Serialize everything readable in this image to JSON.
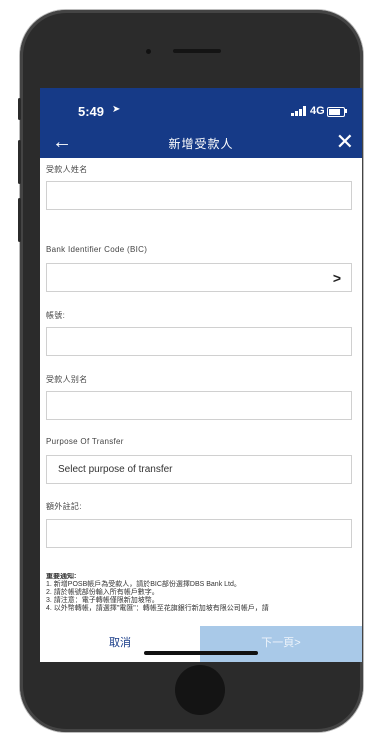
{
  "status_bar": {
    "time": "5:49",
    "network": "4G"
  },
  "header": {
    "title": "新增受款人",
    "back_icon": "arrow-left-icon",
    "close_icon": "close-icon"
  },
  "form": {
    "payee_name_label": "受款人姓名",
    "payee_name_value": "",
    "bic_label": "Bank Identifier Code (BIC)",
    "bic_value": "",
    "account_label": "帳號:",
    "account_value": "",
    "nickname_label": "受款人别名",
    "nickname_value": "",
    "purpose_label": "Purpose Of Transfer",
    "purpose_selected": "Select purpose of transfer",
    "remark_label": "額外註記:",
    "remark_value": ""
  },
  "notice": {
    "title": "重要通知:",
    "lines": [
      "1. 新增POSB帳戶為受款人，請於BIC部份選擇DBS Bank Ltd。",
      "2. 請於帳號部份輸入所有帳戶數字。",
      "3. 請注意：電子轉帳僅限新加坡幣。",
      "4. 以外幣轉帳，請選擇\"電匯\"：轉帳至花旗銀行新加坡有限公司帳戶，請"
    ]
  },
  "actions": {
    "cancel_label": "取消",
    "next_label": "下一頁>"
  },
  "colors": {
    "header_bg": "#163a87",
    "next_button_bg": "#a9c9e8",
    "cancel_text": "#163a87"
  }
}
